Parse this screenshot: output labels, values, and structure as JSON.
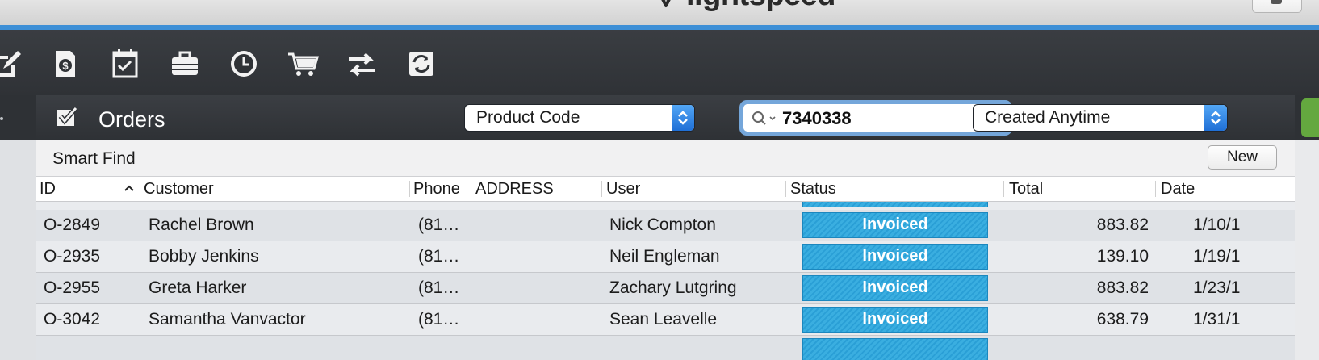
{
  "titlebar": {
    "logo_text": "lightspeed"
  },
  "toolbar": {
    "icons": [
      "edit-icon",
      "invoice-icon",
      "checklist-icon",
      "briefcase-icon",
      "clock-icon",
      "cart-icon",
      "transfer-icon",
      "sync-icon"
    ]
  },
  "header": {
    "title": "Orders",
    "field_select": "Product Code",
    "search_value": "7340338",
    "date_select": "Created Anytime"
  },
  "smart_find": {
    "label": "Smart Find",
    "new_label": "New"
  },
  "columns": [
    "ID",
    "Customer",
    "Phone",
    "ADDRESS",
    "User",
    "Status",
    "Total",
    "Date"
  ],
  "rows": [
    {
      "id": "O-2849",
      "customer": "Rachel Brown",
      "phone": "(81…",
      "address": "",
      "user": "Nick Compton",
      "status": "Invoiced",
      "total": "883.82",
      "date": "1/10/1"
    },
    {
      "id": "O-2935",
      "customer": "Bobby Jenkins",
      "phone": "(81…",
      "address": "",
      "user": "Neil Engleman",
      "status": "Invoiced",
      "total": "139.10",
      "date": "1/19/1"
    },
    {
      "id": "O-2955",
      "customer": "Greta Harker",
      "phone": "(81…",
      "address": "",
      "user": "Zachary Lutgring",
      "status": "Invoiced",
      "total": "883.82",
      "date": "1/23/1"
    },
    {
      "id": "O-3042",
      "customer": "Samantha Vanvactor",
      "phone": "(81…",
      "address": "",
      "user": "Sean Leavelle",
      "status": "Invoiced",
      "total": "638.79",
      "date": "1/31/1"
    }
  ],
  "colors": {
    "accent": "#3d8fd6",
    "status_invoiced": "#2a9fd6",
    "toolbar_bg": "#2f3236",
    "header_bg": "#2e3135"
  }
}
